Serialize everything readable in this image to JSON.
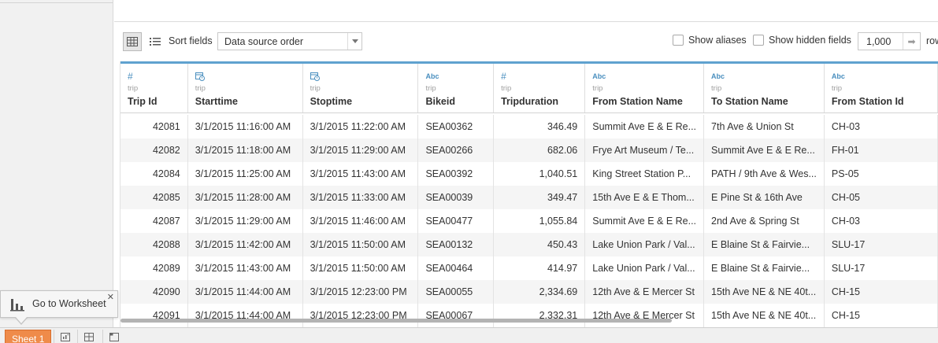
{
  "toolbar": {
    "sort_label": "Sort fields",
    "sort_value": "Data source order",
    "show_aliases": "Show aliases",
    "show_hidden": "Show hidden fields",
    "rows_value": "1,000",
    "rows_label": "rows"
  },
  "grid": {
    "columns": [
      {
        "type": "#",
        "source": "trip",
        "name": "Trip Id"
      },
      {
        "type": "date",
        "source": "trip",
        "name": "Starttime"
      },
      {
        "type": "date",
        "source": "trip",
        "name": "Stoptime"
      },
      {
        "type": "Abc",
        "source": "trip",
        "name": "Bikeid"
      },
      {
        "type": "#",
        "source": "trip",
        "name": "Tripduration"
      },
      {
        "type": "Abc",
        "source": "trip",
        "name": "From Station Name"
      },
      {
        "type": "Abc",
        "source": "trip",
        "name": "To Station Name"
      },
      {
        "type": "Abc",
        "source": "trip",
        "name": "From Station Id"
      }
    ],
    "rows": [
      [
        "42081",
        "3/1/2015 11:16:00 AM",
        "3/1/2015 11:22:00 AM",
        "SEA00362",
        "346.49",
        "Summit Ave E & E Re...",
        "7th Ave & Union St",
        "CH-03"
      ],
      [
        "42082",
        "3/1/2015 11:18:00 AM",
        "3/1/2015 11:29:00 AM",
        "SEA00266",
        "682.06",
        "Frye Art Museum / Te...",
        "Summit Ave E & E Re...",
        "FH-01"
      ],
      [
        "42084",
        "3/1/2015 11:25:00 AM",
        "3/1/2015 11:43:00 AM",
        "SEA00392",
        "1,040.51",
        "King Street Station P...",
        "PATH / 9th Ave & Wes...",
        "PS-05"
      ],
      [
        "42085",
        "3/1/2015 11:28:00 AM",
        "3/1/2015 11:33:00 AM",
        "SEA00039",
        "349.47",
        "15th Ave E & E Thom...",
        "E Pine St & 16th Ave",
        "CH-05"
      ],
      [
        "42087",
        "3/1/2015 11:29:00 AM",
        "3/1/2015 11:46:00 AM",
        "SEA00477",
        "1,055.84",
        "Summit Ave E & E Re...",
        "2nd Ave & Spring St",
        "CH-03"
      ],
      [
        "42088",
        "3/1/2015 11:42:00 AM",
        "3/1/2015 11:50:00 AM",
        "SEA00132",
        "450.43",
        "Lake Union Park / Val...",
        "E Blaine St & Fairvie...",
        "SLU-17"
      ],
      [
        "42089",
        "3/1/2015 11:43:00 AM",
        "3/1/2015 11:50:00 AM",
        "SEA00464",
        "414.97",
        "Lake Union Park / Val...",
        "E Blaine St & Fairvie...",
        "SLU-17"
      ],
      [
        "42090",
        "3/1/2015 11:44:00 AM",
        "3/1/2015 12:23:00 PM",
        "SEA00055",
        "2,334.69",
        "12th Ave & E Mercer St",
        "15th Ave NE & NE 40t...",
        "CH-15"
      ],
      [
        "42091",
        "3/1/2015 11:44:00 AM",
        "3/1/2015 12:23:00 PM",
        "SEA00067",
        "2,332.31",
        "12th Ave & E Mercer St",
        "15th Ave NE & NE 40t...",
        "CH-15"
      ]
    ]
  },
  "tabbar": {
    "sheet_tab": "Sheet 1",
    "icons": [
      "new-worksheet-icon",
      "new-dashboard-icon",
      "new-story-icon"
    ]
  },
  "tooltip": {
    "label": "Go to Worksheet",
    "close": "✕"
  },
  "colors": {
    "accent": "#5fa2cf",
    "sheet_tab": "#ef8b4a"
  }
}
